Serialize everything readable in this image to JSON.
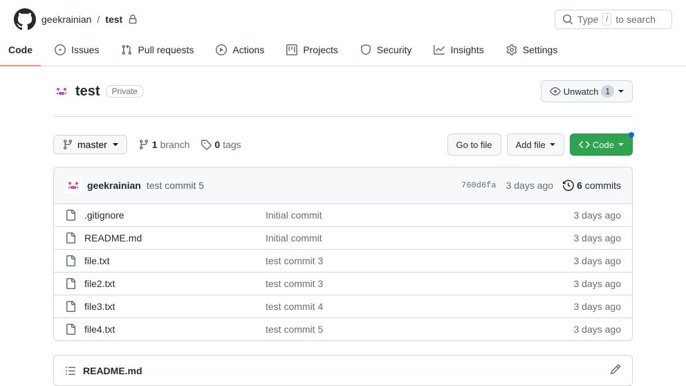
{
  "breadcrumb": {
    "owner": "geekrainian",
    "repo": "test"
  },
  "search": {
    "prefix": "Type",
    "key": "/",
    "suffix": "to search"
  },
  "nav": {
    "code": "Code",
    "issues": "Issues",
    "pull_requests": "Pull requests",
    "actions": "Actions",
    "projects": "Projects",
    "security": "Security",
    "insights": "Insights",
    "settings": "Settings"
  },
  "repo": {
    "title": "test",
    "visibility": "Private",
    "unwatch_label": "Unwatch",
    "unwatch_count": "1"
  },
  "toolbar": {
    "branch": "master",
    "branch_count": "1",
    "branch_label": "branch",
    "tag_count": "0",
    "tag_label": "tags",
    "go_to_file": "Go to file",
    "add_file": "Add file",
    "code": "Code"
  },
  "commit": {
    "author": "geekrainian",
    "message": "test commit 5",
    "hash": "760d6fa",
    "date": "3 days ago",
    "count": "6",
    "commits_label": "commits"
  },
  "files": [
    {
      "name": ".gitignore",
      "commit": "Initial commit",
      "date": "3 days ago"
    },
    {
      "name": "README.md",
      "commit": "Initial commit",
      "date": "3 days ago"
    },
    {
      "name": "file.txt",
      "commit": "test commit 3",
      "date": "3 days ago"
    },
    {
      "name": "file2.txt",
      "commit": "test commit 3",
      "date": "3 days ago"
    },
    {
      "name": "file3.txt",
      "commit": "test commit 4",
      "date": "3 days ago"
    },
    {
      "name": "file4.txt",
      "commit": "test commit 5",
      "date": "3 days ago"
    }
  ],
  "readme": {
    "title": "README.md"
  }
}
